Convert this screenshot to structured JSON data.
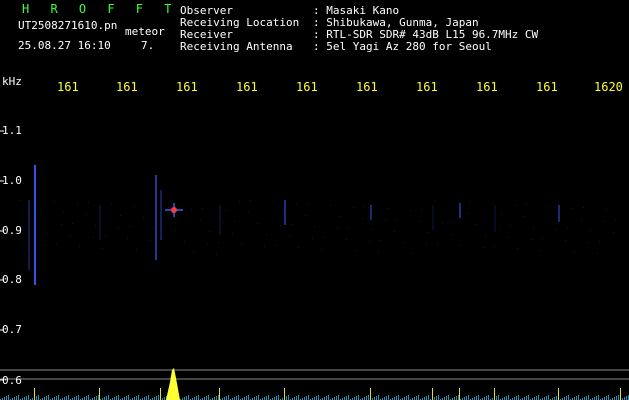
{
  "header": {
    "app_name": "H R O F F T",
    "file_name": "UT2508271610.pn",
    "meteor_label": "meteor",
    "date_time": "25.08.27 16:10",
    "meteor_count": "7.",
    "info": [
      {
        "label": "Observer",
        "value": ": Masaki Kano"
      },
      {
        "label": "Receiving Location",
        "value": ": Shibukawa, Gunma, Japan"
      },
      {
        "label": "Receiver",
        "value": ": RTL-SDR SDR# 43dB L15 96.7MHz CW"
      },
      {
        "label": "Receiving Antenna",
        "value": ": 5el Yagi Az 280 for Seoul"
      }
    ]
  },
  "axis": {
    "unit_label": "kHz",
    "time_ticks": [
      "161",
      "161",
      "161",
      "161",
      "161",
      "161",
      "161",
      "161",
      "161",
      "1620"
    ],
    "freq_ticks": [
      "1.1",
      "1.0",
      "0.9",
      "0.8",
      "0.7",
      "0.6"
    ]
  },
  "colors": {
    "background": "#000000",
    "text": "#ffffff",
    "title": "#3cff3c",
    "tick": "#ffff33",
    "echo": "#3a5cff",
    "signal_peak": "#ffff33"
  }
}
